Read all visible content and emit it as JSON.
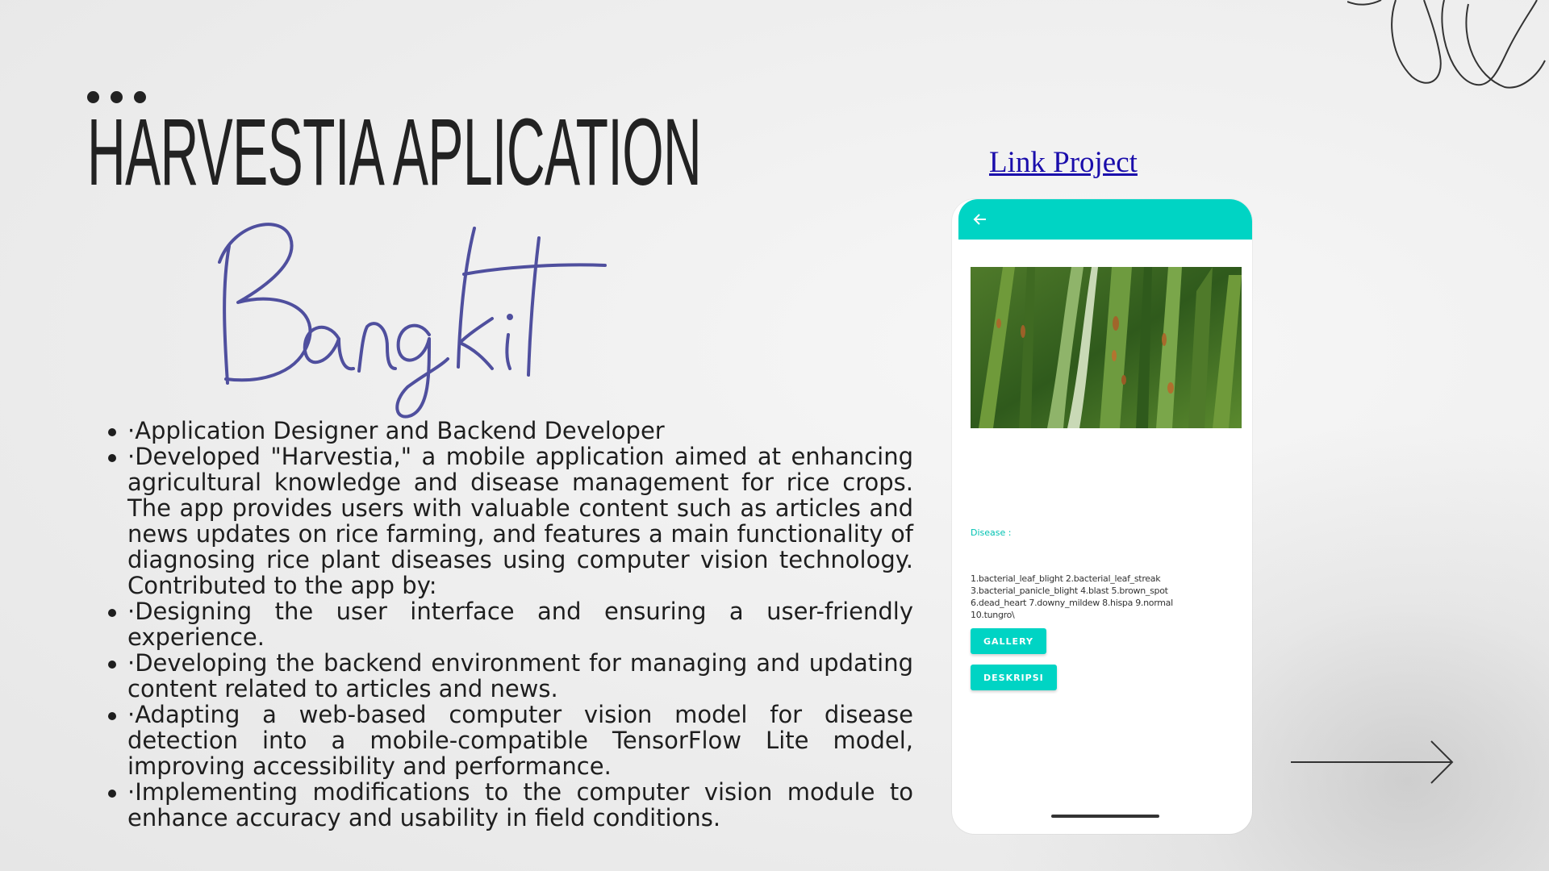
{
  "slide": {
    "title": "HARVESTIA APLICATION",
    "script_text": "Bangkit",
    "link_text": "Link Project",
    "bullets": [
      "·Application Designer and Backend Developer",
      "·Developed \"Harvestia,\" a mobile application aimed at enhancing agricultural knowledge and disease management for rice crops. The app provides users with valuable content such as articles and news updates on rice farming, and features a main functionality of diagnosing rice plant diseases using computer vision technology. Contributed to the app by:",
      "·Designing the user interface and ensuring a user-friendly experience.",
      "·Developing the backend environment for managing and updating content related to articles and news.",
      "·Adapting a web-based computer vision model for disease detection into a mobile-compatible TensorFlow Lite model, improving accessibility and performance.",
      "·Implementing modifications to the computer vision module to enhance accuracy and usability in field conditions."
    ]
  },
  "app": {
    "back_icon": "arrow-left-icon",
    "disease_label": "Disease :",
    "disease_list": "1.bacterial_leaf_blight 2.bacterial_leaf_streak 3.bacterial_panicle_blight 4.blast 5.brown_spot 6.dead_heart 7.downy_mildew 8.hispa 9.normal 10.tungro\\",
    "gallery_button": "GALLERY",
    "deskripsi_button": "DESKRIPSI"
  },
  "colors": {
    "accent": "#00d4c4",
    "script": "#4f4f9e",
    "link": "#1a0dab",
    "text": "#1e1e1e"
  }
}
